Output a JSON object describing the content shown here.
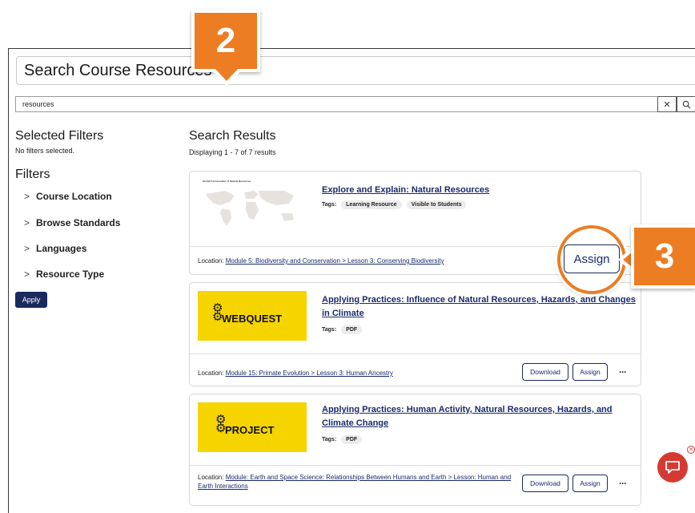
{
  "search": {
    "title": "Search Course Resources",
    "value": "resources",
    "clear_icon": "close-icon",
    "search_icon": "search-icon"
  },
  "sidebar": {
    "selected_heading": "Selected Filters",
    "no_filters": "No filters selected.",
    "filters_heading": "Filters",
    "filters": [
      {
        "label": "Course Location"
      },
      {
        "label": "Browse Standards"
      },
      {
        "label": "Languages"
      },
      {
        "label": "Resource Type"
      }
    ],
    "apply_label": "Apply"
  },
  "results": {
    "heading": "Search Results",
    "count": "Displaying 1 - 7 of 7 results",
    "items": [
      {
        "title": "Explore and Explain: Natural Resources",
        "tags_label": "Tags:",
        "tags": [
          "Learning Resource",
          "Visible to Students"
        ],
        "thumb_caption": "Global Conservation of Natural Resources",
        "location_label": "Location:",
        "location_link": "Module 5: Biodiversity and Conservation > Lesson 3: Conserving Biodiversity",
        "assign_label": "Assign"
      },
      {
        "title": "Applying Practices: Influence of Natural Resources, Hazards, and Changes in Climate",
        "tags_label": "Tags:",
        "tags": [
          "PDF"
        ],
        "thumb_text": "WEBQUEST",
        "location_label": "Location:",
        "location_link": "Module 15: Primate Evolution > Lesson 3: Human Ancestry",
        "download_label": "Download",
        "assign_label": "Assign",
        "more_label": "···"
      },
      {
        "title": "Applying Practices: Human Activity, Natural Resources, Hazards, and Climate Change",
        "tags_label": "Tags:",
        "tags": [
          "PDF"
        ],
        "thumb_text": "PROJECT",
        "location_label": "Location:",
        "location_link": "Module: Earth and Space Science: Relationships Between Humans and Earth > Lesson: Human and Earth Interactions",
        "download_label": "Download",
        "assign_label": "Assign",
        "more_label": "···"
      }
    ]
  },
  "callouts": {
    "step2": "2",
    "step3": "3",
    "accent": "#ec7d22"
  },
  "chat": {
    "icon": "chat-icon",
    "close_icon": "close-icon",
    "color": "#d53a32"
  }
}
